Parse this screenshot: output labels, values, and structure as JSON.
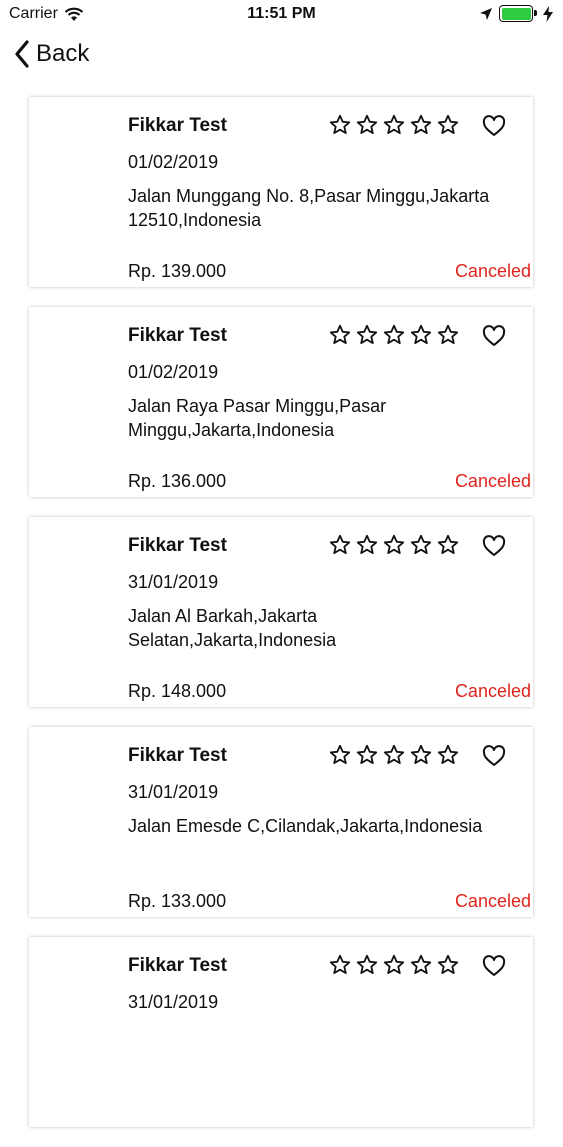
{
  "status_bar": {
    "carrier": "Carrier",
    "time": "11:51 PM"
  },
  "nav": {
    "back_label": "Back"
  },
  "colors": {
    "status_canceled": "#e0241c",
    "battery": "#2ecc40"
  },
  "orders": [
    {
      "name": "Fikkar Test",
      "date": "01/02/2019",
      "address": "Jalan Munggang No. 8,Pasar Minggu,Jakarta 12510,Indonesia",
      "price": "Rp. 139.000",
      "status": "Canceled",
      "rating": 0
    },
    {
      "name": "Fikkar Test",
      "date": "01/02/2019",
      "address": "Jalan Raya Pasar Minggu,Pasar Minggu,Jakarta,Indonesia",
      "price": "Rp. 136.000",
      "status": "Canceled",
      "rating": 0
    },
    {
      "name": "Fikkar Test",
      "date": "31/01/2019",
      "address": "Jalan Al Barkah,Jakarta Selatan,Jakarta,Indonesia",
      "price": "Rp. 148.000",
      "status": "Canceled",
      "rating": 0
    },
    {
      "name": "Fikkar Test",
      "date": "31/01/2019",
      "address": "Jalan Emesde C,Cilandak,Jakarta,Indonesia",
      "price": "Rp. 133.000",
      "status": "Canceled",
      "rating": 0
    },
    {
      "name": "Fikkar Test",
      "date": "31/01/2019",
      "address": "",
      "price": "",
      "status": "",
      "rating": 0
    }
  ]
}
